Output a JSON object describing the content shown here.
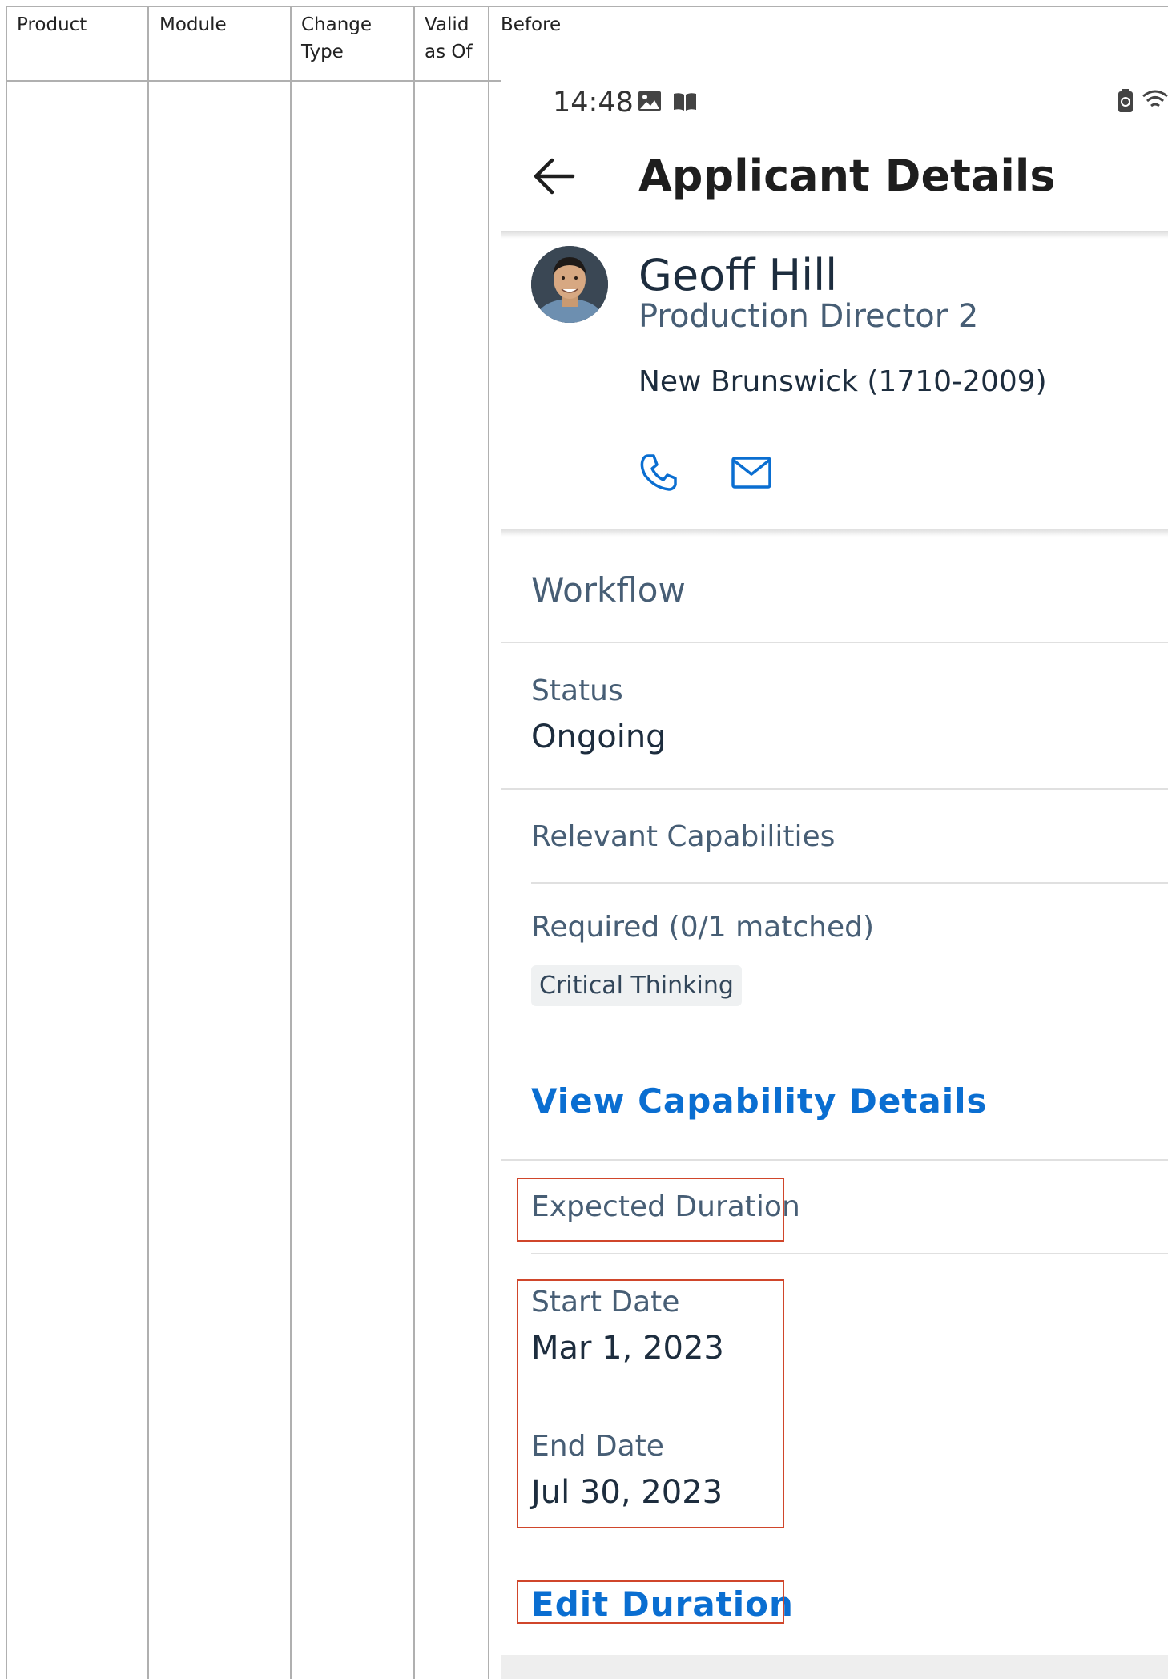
{
  "table": {
    "headers": {
      "product": "Product",
      "module": "Module",
      "change_type_line1": "Change",
      "change_type_line2": "Type",
      "valid_line1": "Valid",
      "valid_line2": "as Of",
      "before": "Before"
    }
  },
  "phone": {
    "status_bar": {
      "time": "14:48"
    },
    "header": {
      "title": "Applicant Details"
    },
    "applicant": {
      "name": "Geoff Hill",
      "job_title": "Production Director 2",
      "location": "New Brunswick (1710-2009)"
    },
    "workflow": {
      "label": "Workflow"
    },
    "status": {
      "label": "Status",
      "value": "Ongoing"
    },
    "capabilities": {
      "section_label": "Relevant Capabilities",
      "required_label": "Required (0/1 matched)",
      "chip": "Critical Thinking",
      "link": "View Capability Details"
    },
    "duration": {
      "section_label": "Expected Duration",
      "start_label": "Start Date",
      "start_value": "Mar 1, 2023",
      "end_label": "End Date",
      "end_value": "Jul 30, 2023",
      "edit_link": "Edit Duration"
    }
  },
  "colors": {
    "link": "#0a6ed1",
    "highlight_border": "#d0462b",
    "label": "#475e75",
    "text": "#1d2d3e"
  }
}
